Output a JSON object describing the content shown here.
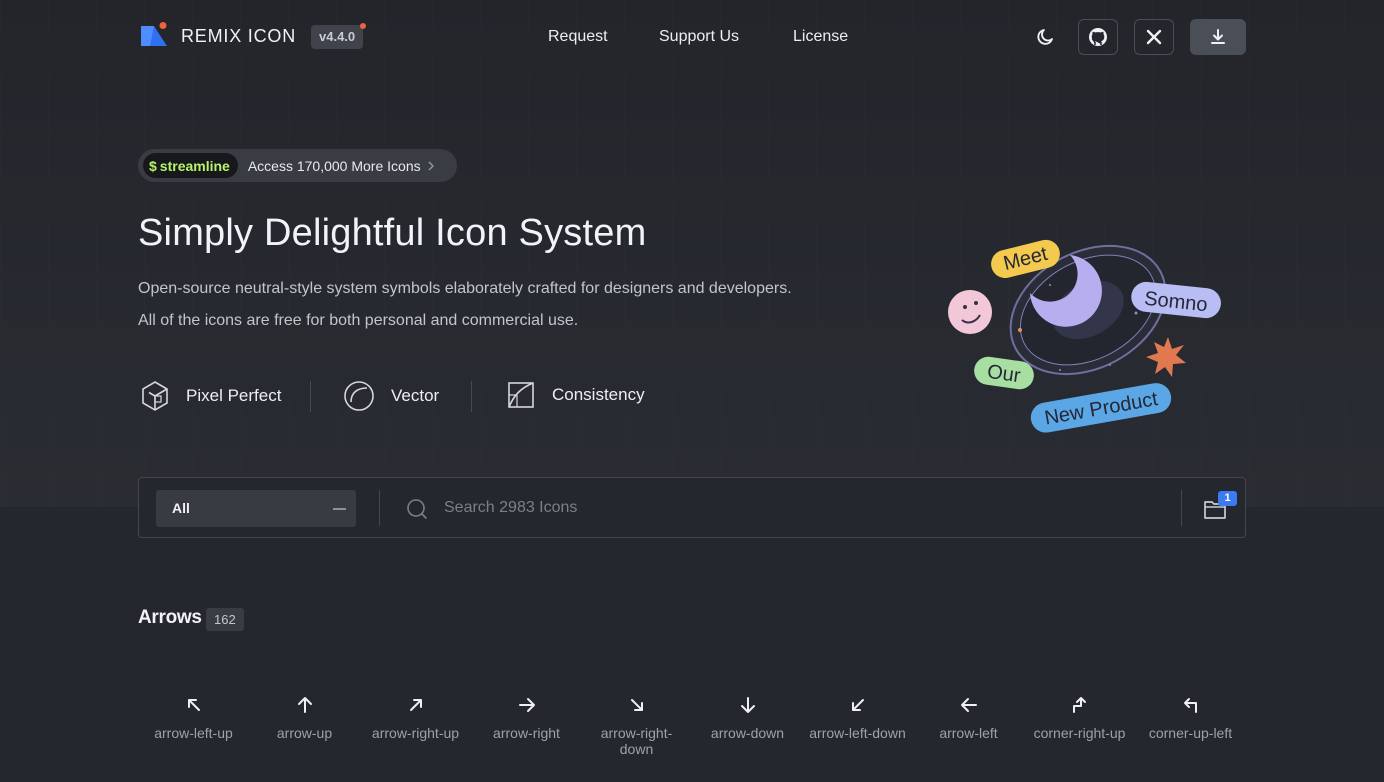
{
  "header": {
    "brand": "REMIX ICON",
    "version": "v4.4.0",
    "nav": [
      "Request",
      "Support Us",
      "License"
    ],
    "buttons": [
      "moon-icon",
      "github-icon",
      "x-icon",
      "download-icon"
    ]
  },
  "promo": {
    "brand": "streamline",
    "text": "Access 170,000 More Icons"
  },
  "hero": {
    "title": "Simply Delightful Icon System",
    "line1": "Open-source neutral-style system symbols elaborately crafted for designers and developers.",
    "line2": "All of the icons are free for both personal and commercial use.",
    "features": [
      "Pixel Perfect",
      "Vector",
      "Consistency"
    ]
  },
  "illustration": {
    "labels": [
      "Meet",
      "Somno",
      "Our",
      "New Product"
    ]
  },
  "search": {
    "category": "All",
    "placeholder": "Search 2983 Icons",
    "collection_count": "1"
  },
  "category": {
    "name": "Arrows",
    "count": "162"
  },
  "icons": [
    "arrow-left-up",
    "arrow-up",
    "arrow-right-up",
    "arrow-right",
    "arrow-right-down",
    "arrow-down",
    "arrow-left-down",
    "arrow-left",
    "corner-right-up",
    "corner-up-left"
  ],
  "colors": {
    "background": "#25272e",
    "accent_blue": "#3a7cf0",
    "streamline_green": "#b7f36a",
    "version_dot": "#f0613d"
  }
}
